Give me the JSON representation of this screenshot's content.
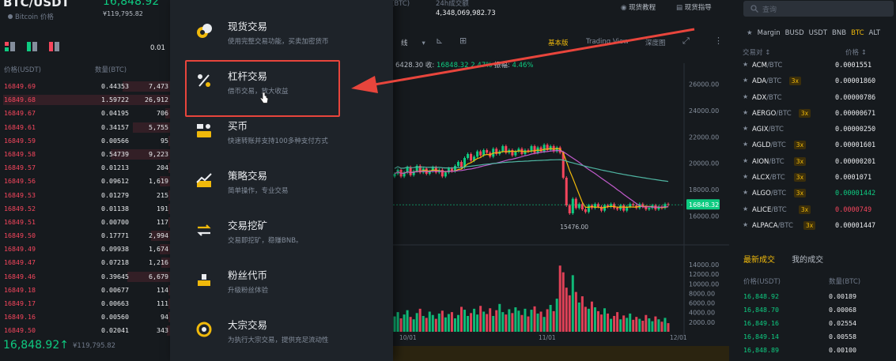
{
  "header": {
    "pair": "BTC/USDT",
    "pair_sub": "Bitcoin 价格",
    "price": "16,848.92",
    "price_cny": "¥119,795.82",
    "volume_label": "24h成交额",
    "volume_unit": "(BTC)",
    "volume_value": "4,348,069,982.73",
    "tutorial": "现货教程",
    "guide": "现货指导"
  },
  "orderbook": {
    "precision": "0.01",
    "col_price": "价格(USDT)",
    "col_qty": "数量(BTC)",
    "asks": [
      {
        "price": "16849.69",
        "qty": "0.44353",
        "total": "7,473",
        "depth": 0.28
      },
      {
        "price": "16849.68",
        "qty": "1.59722",
        "total": "26,912",
        "depth": 0.98
      },
      {
        "price": "16849.67",
        "qty": "0.04195",
        "total": "706",
        "depth": 0.03
      },
      {
        "price": "16849.61",
        "qty": "0.34157",
        "total": "5,755",
        "depth": 0.22
      },
      {
        "price": "16849.59",
        "qty": "0.00566",
        "total": "95",
        "depth": 0.01
      },
      {
        "price": "16849.58",
        "qty": "0.54739",
        "total": "9,223",
        "depth": 0.35
      },
      {
        "price": "16849.57",
        "qty": "0.01213",
        "total": "204",
        "depth": 0.01
      },
      {
        "price": "16849.56",
        "qty": "0.09612",
        "total": "1,619",
        "depth": 0.06
      },
      {
        "price": "16849.53",
        "qty": "0.01279",
        "total": "215",
        "depth": 0.01
      },
      {
        "price": "16849.52",
        "qty": "0.01138",
        "total": "191",
        "depth": 0.01
      },
      {
        "price": "16849.51",
        "qty": "0.00700",
        "total": "117",
        "depth": 0.01
      },
      {
        "price": "16849.50",
        "qty": "0.17771",
        "total": "2,994",
        "depth": 0.11
      },
      {
        "price": "16849.49",
        "qty": "0.09938",
        "total": "1,674",
        "depth": 0.06
      },
      {
        "price": "16849.47",
        "qty": "0.07218",
        "total": "1,216",
        "depth": 0.05
      },
      {
        "price": "16849.46",
        "qty": "0.39645",
        "total": "6,679",
        "depth": 0.25
      },
      {
        "price": "16849.18",
        "qty": "0.00677",
        "total": "114",
        "depth": 0.01
      },
      {
        "price": "16849.17",
        "qty": "0.00663",
        "total": "111",
        "depth": 0.01
      },
      {
        "price": "16849.16",
        "qty": "0.00560",
        "total": "94",
        "depth": 0.01
      },
      {
        "price": "16849.50",
        "qty": "0.02041",
        "total": "343",
        "depth": 0.02
      }
    ],
    "last_price": "16,848.92↑",
    "last_cny": "¥119,795.82"
  },
  "menu": {
    "items": [
      {
        "title": "现货交易",
        "desc": "使用完整交易功能，买卖加密货币",
        "icon": "spot-coins-icon"
      },
      {
        "title": "杠杆交易",
        "desc": "借币交易，放大收益",
        "icon": "margin-percent-icon"
      },
      {
        "title": "买币",
        "desc": "快速转账并支持100多种支付方式",
        "icon": "buy-crypto-icon"
      },
      {
        "title": "策略交易",
        "desc": "简单操作，专业交易",
        "icon": "strategy-chart-icon"
      },
      {
        "title": "交易挖矿",
        "desc": "交易即挖矿，稳赚BNB。",
        "icon": "trade-mining-icon"
      },
      {
        "title": "粉丝代币",
        "desc": "升级粉丝体验",
        "icon": "fan-token-icon"
      },
      {
        "title": "大宗交易",
        "desc": "为执行大宗交易，提供充足流动性",
        "icon": "block-trade-icon"
      }
    ]
  },
  "chart": {
    "toolbar_basic": "基本版",
    "toolbar_tv": "Trading View",
    "toolbar_depth": "深度图",
    "ohlc_close": "6428.30",
    "ohlc_close_label": "收:",
    "ohlc_close_value": "16848.32",
    "ohlc_change": "2.47%",
    "ohlc_amp_label": "振幅:",
    "ohlc_amp": "4.46%",
    "price_axis": [
      "26000.00",
      "24000.00",
      "22000.00",
      "20000.00",
      "18000.00",
      "16000.00"
    ],
    "volume_axis": [
      "14000.00",
      "12000.00",
      "10000.00",
      "8000.00",
      "6000.00",
      "4000.00",
      "2000.00"
    ],
    "current_price_tag": "16848.32",
    "low_label": "15476.00",
    "x_labels": [
      "10/01",
      "11/01",
      "12/01"
    ]
  },
  "chart_data": {
    "type": "candlestick",
    "ylim": [
      15000,
      27000
    ],
    "close": [
      19200,
      19500,
      19000,
      19300,
      19700,
      19100,
      19400,
      19800,
      19300,
      19600,
      19200,
      19400,
      19700,
      19300,
      19500,
      19000,
      19300,
      19600,
      19400,
      19800,
      20100,
      19700,
      20400,
      20700,
      20200,
      20500,
      20900,
      20600,
      21000,
      20800,
      20500,
      21100,
      20700,
      20900,
      21300,
      20800,
      21000,
      20600,
      20900,
      21100,
      20700,
      21000,
      20900,
      21300,
      20800,
      21200,
      20900,
      21400,
      21000,
      21300,
      20900,
      21200,
      20800,
      18900,
      16800,
      16200,
      17300,
      16600,
      16900,
      16500,
      16300,
      16800,
      16600,
      16900,
      16700,
      16400,
      16800,
      16700,
      16900,
      16600,
      16500,
      16800,
      16400,
      16700,
      16900,
      16800,
      16600,
      16900,
      16700,
      16500,
      16600,
      16800,
      16500,
      16700,
      16600,
      16900,
      16848
    ],
    "volume": [
      3200,
      4100,
      2800,
      3600,
      4500,
      3100,
      2600,
      3900,
      4800,
      3300,
      2900,
      4200,
      3500,
      2700,
      3800,
      4400,
      3000,
      3700,
      4100,
      2800,
      3500,
      5200,
      4600,
      3300,
      3900,
      4800,
      3600,
      5400,
      4200,
      3700,
      4900,
      3300,
      4500,
      5800,
      4100,
      3600,
      4700,
      3900,
      5100,
      4400,
      3500,
      4800,
      3200,
      4600,
      5300,
      3800,
      4200,
      3100,
      4700,
      5600,
      4300,
      6900,
      13800,
      12400,
      9200,
      7600,
      11800,
      8300,
      6100,
      7400,
      5200,
      4800,
      6300,
      5100,
      4300,
      3600,
      4900,
      3800,
      2700,
      3300,
      4100,
      2600,
      3400,
      2900,
      3800,
      2500,
      3100,
      2700,
      2300,
      3500,
      2800,
      2200,
      3200,
      2600,
      2100,
      2900,
      1800
    ]
  },
  "market": {
    "search_placeholder": "查询",
    "tabs": [
      "Margin",
      "BUSD",
      "USDT",
      "BNB",
      "BTC",
      "ALT"
    ],
    "active_tab": "BTC",
    "col_pair": "交易对 ↕",
    "col_price": "价格 ↕",
    "rows": [
      {
        "base": "ACM",
        "quote": "/BTC",
        "lev": "",
        "price": "0.0001551",
        "color": "#eaecef"
      },
      {
        "base": "ADA",
        "quote": "/BTC",
        "lev": "3x",
        "price": "0.00001860",
        "color": "#eaecef"
      },
      {
        "base": "ADX",
        "quote": "/BTC",
        "lev": "",
        "price": "0.00000786",
        "color": "#eaecef"
      },
      {
        "base": "AERGO",
        "quote": "/BTC",
        "lev": "3x",
        "price": "0.00000671",
        "color": "#eaecef"
      },
      {
        "base": "AGIX",
        "quote": "/BTC",
        "lev": "",
        "price": "0.00000250",
        "color": "#eaecef"
      },
      {
        "base": "AGLD",
        "quote": "/BTC",
        "lev": "3x",
        "price": "0.00001601",
        "color": "#eaecef"
      },
      {
        "base": "AION",
        "quote": "/BTC",
        "lev": "3x",
        "price": "0.00000201",
        "color": "#eaecef"
      },
      {
        "base": "ALCX",
        "quote": "/BTC",
        "lev": "3x",
        "price": "0.0001071",
        "color": "#eaecef"
      },
      {
        "base": "ALGO",
        "quote": "/BTC",
        "lev": "3x",
        "price": "0.00001442",
        "color": "#0ecb81"
      },
      {
        "base": "ALICE",
        "quote": "/BTC",
        "lev": "3x",
        "price": "0.0000749",
        "color": "#f6465d"
      },
      {
        "base": "ALPACA",
        "quote": "/BTC",
        "lev": "3x",
        "price": "0.00001447",
        "color": "#eaecef"
      }
    ],
    "trades_tab_active": "最新成交",
    "trades_tab_mine": "我的成交",
    "trades_col_price": "价格(USDT)",
    "trades_col_qty": "数量(BTC)",
    "trades": [
      {
        "price": "16,848.92",
        "qty": "0.00189"
      },
      {
        "price": "16,848.70",
        "qty": "0.00068"
      },
      {
        "price": "16,849.16",
        "qty": "0.02554"
      },
      {
        "price": "16,849.14",
        "qty": "0.00558"
      },
      {
        "price": "16,848.89",
        "qty": "0.00100"
      }
    ]
  },
  "colors": {
    "up": "#0ecb81",
    "down": "#f6465d",
    "accent": "#f0b90b",
    "highlight": "#e8453c"
  }
}
